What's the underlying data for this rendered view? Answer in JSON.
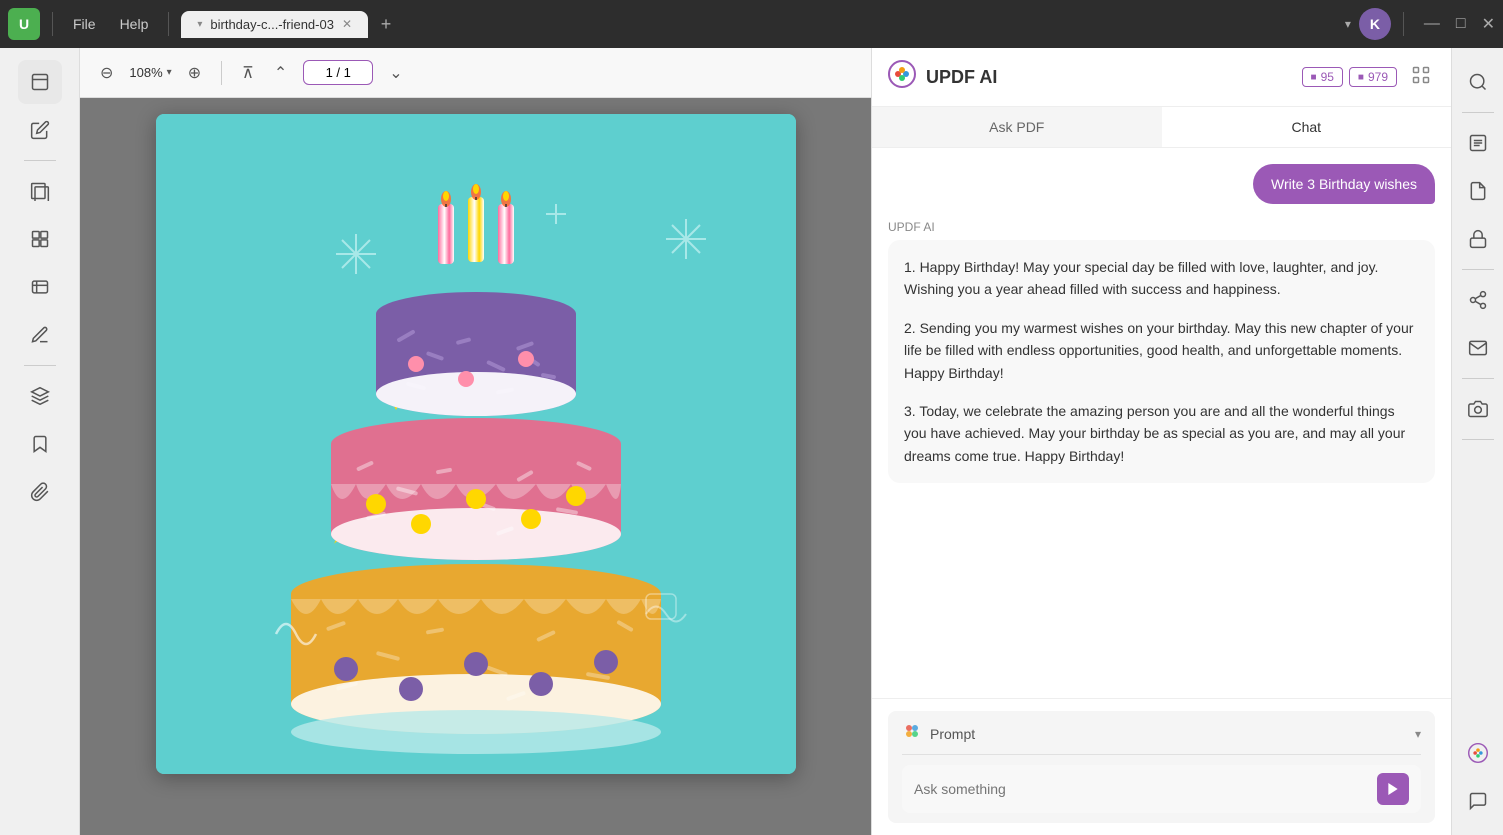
{
  "titlebar": {
    "logo": "UPDF",
    "file_menu": "File",
    "help_menu": "Help",
    "tab_name": "birthday-c...-friend-03",
    "user_initial": "K"
  },
  "toolbar": {
    "zoom_level": "108%",
    "page_current": "1",
    "page_total": "1"
  },
  "ai_panel": {
    "title": "UPDF AI",
    "credit1_icon": "■",
    "credit1_value": "95",
    "credit2_icon": "■",
    "credit2_value": "979",
    "tab_ask": "Ask PDF",
    "tab_chat": "Chat",
    "user_message": "Write 3 Birthday wishes",
    "ai_label": "UPDF AI",
    "ai_response_p1": "1. Happy Birthday! May your special day be filled with love, laughter, and joy. Wishing you a year ahead filled with success and happiness.",
    "ai_response_p2": "2. Sending you my warmest wishes on your birthday. May this new chapter of your life be filled with endless opportunities, good health, and unforgettable moments. Happy Birthday!",
    "ai_response_p3": "3. Today, we celebrate the amazing person you are and all the wonderful things you have achieved. May your birthday be as special as you are, and may all your dreams come true. Happy Birthday!",
    "prompt_label": "Prompt",
    "ask_placeholder": "Ask something"
  }
}
